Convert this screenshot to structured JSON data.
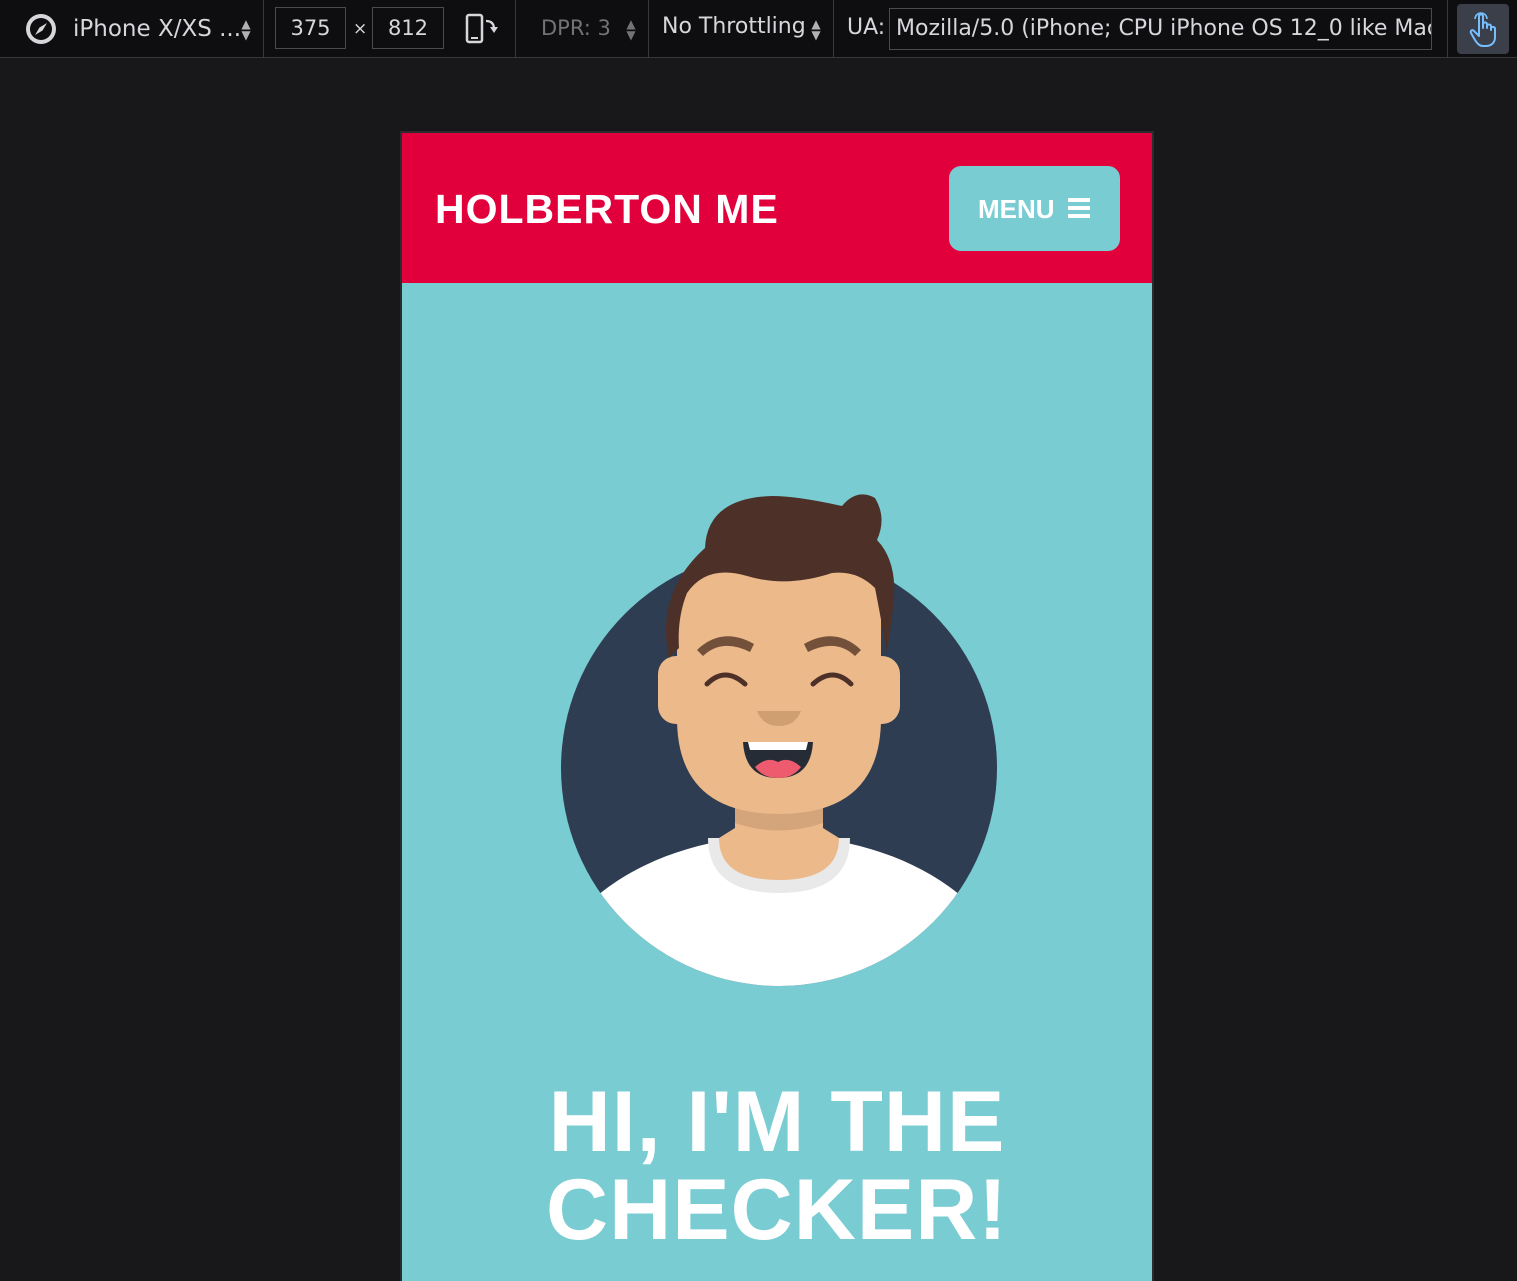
{
  "devtools": {
    "device_name": "iPhone X/XS ...",
    "width_value": "375",
    "times_sign": "×",
    "height_value": "812",
    "dpr_label": "DPR: 3",
    "throttling_label": "No Throttling",
    "ua_label": "UA:",
    "ua_value": "Mozilla/5.0 (iPhone; CPU iPhone OS 12_0 like Mac"
  },
  "page": {
    "logo": "HOLBERTON ME",
    "menu_label": "MENU",
    "hero_line1": "HI, I'M THE",
    "hero_line2": "CHECKER!"
  },
  "colors": {
    "header_bg": "#e1003c",
    "page_bg": "#78ccd2",
    "avatar_circle": "#2e3d51",
    "skin": "#ecb98b",
    "hair": "#4d3129",
    "shirt": "#ffffff"
  },
  "icons": {
    "devtools_logo": "compass-icon",
    "rotate": "rotate-device-icon",
    "touch": "touch-hand-icon",
    "menu": "hamburger-icon"
  }
}
